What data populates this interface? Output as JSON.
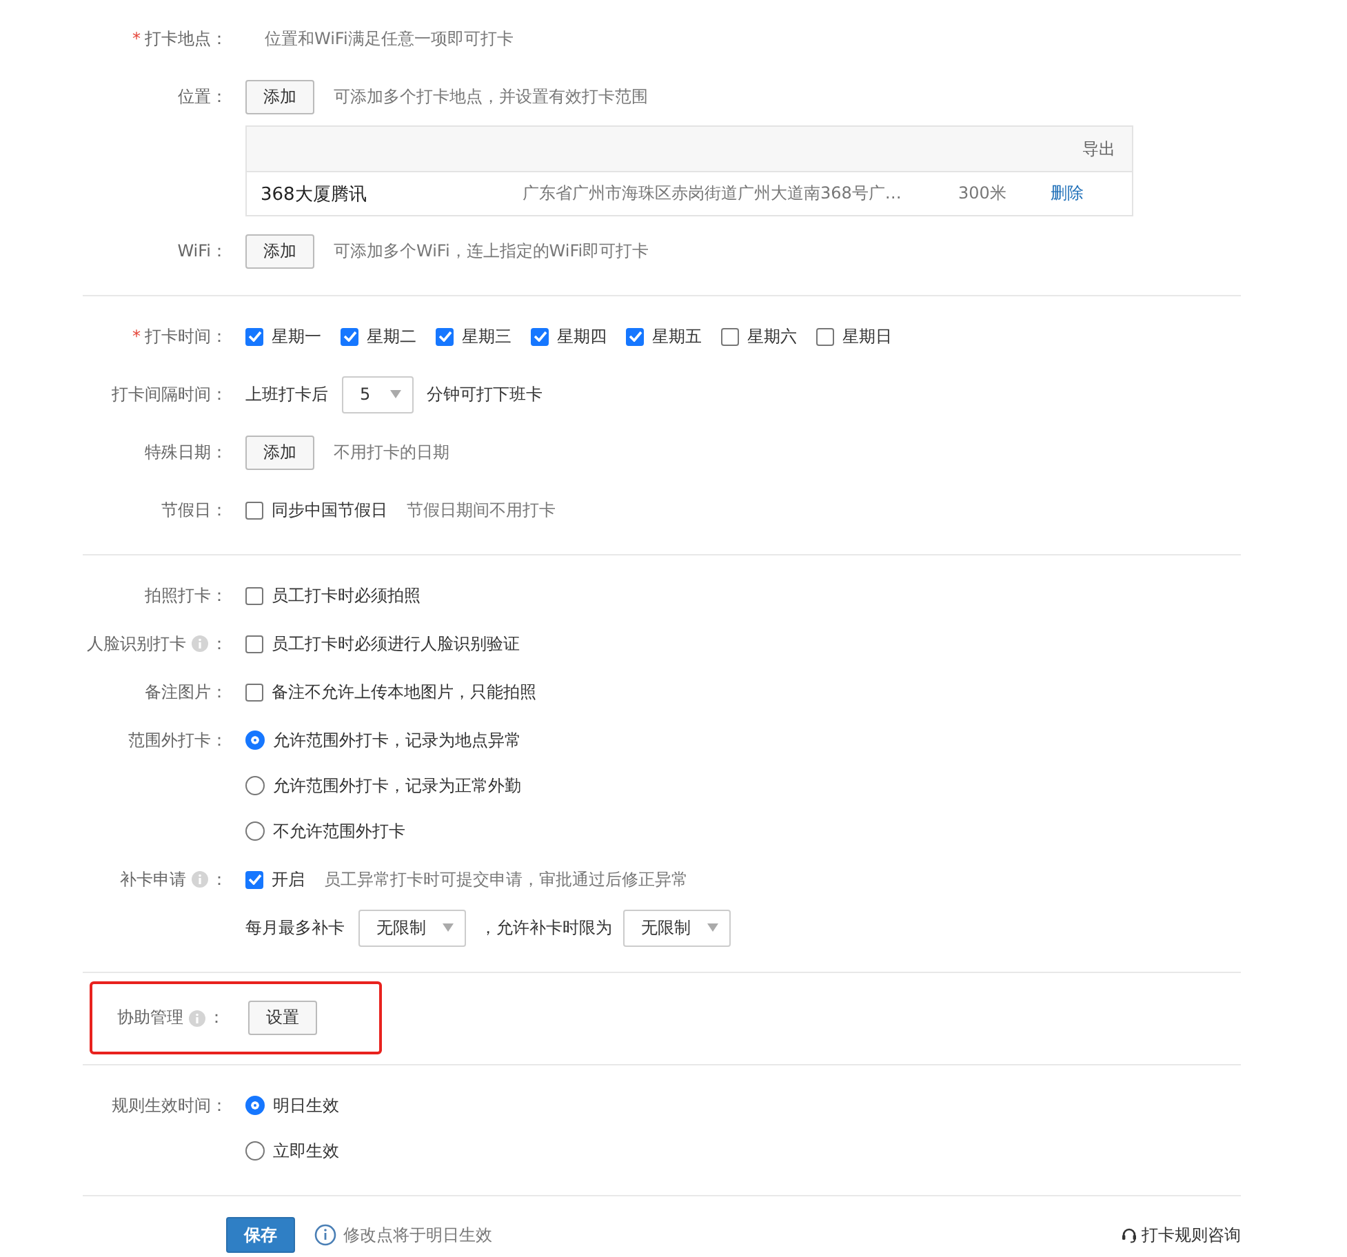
{
  "sections": [
    {
      "rows": [
        {
          "kind": "hint",
          "label": {
            "text": "打卡地点：",
            "mark": "*"
          },
          "text": "位置和WiFi满足任意一项即可打卡"
        },
        {
          "kind": "button",
          "label": {
            "text": "位置："
          },
          "button": "添加",
          "hint": "可添加多个打卡地点，并设置有效打卡范围"
        },
        {
          "kind": "table",
          "header": "导出",
          "rows": [
            {
              "name": "368大厦腾讯",
              "address": "广东省广州市海珠区赤岗街道广州大道南368号广…",
              "range": "300米",
              "action": "删除"
            }
          ]
        },
        {
          "kind": "button",
          "label": {
            "text": "WiFi："
          },
          "button": "添加",
          "hint": "可添加多个WiFi，连上指定的WiFi即可打卡"
        }
      ]
    },
    {
      "rows": [
        {
          "kind": "checks",
          "label": {
            "text": "打卡时间：",
            "mark": "*"
          },
          "options": [
            {
              "text": "星期一",
              "checked": true
            },
            {
              "text": "星期二",
              "checked": true
            },
            {
              "text": "星期三",
              "checked": true
            },
            {
              "text": "星期四",
              "checked": true
            },
            {
              "text": "星期五",
              "checked": true
            },
            {
              "text": "星期六",
              "checked": false
            },
            {
              "text": "星期日",
              "checked": false
            }
          ]
        },
        {
          "kind": "interval",
          "label": {
            "text": "打卡间隔时间："
          },
          "before": "上班打卡后",
          "select": "5",
          "after": "分钟可打下班卡"
        },
        {
          "kind": "button",
          "label": {
            "text": "特殊日期："
          },
          "button": "添加",
          "hint": "不用打卡的日期"
        },
        {
          "kind": "check",
          "label": {
            "text": "节假日："
          },
          "checked": false,
          "text": "同步中国节假日",
          "hint": "节假日期间不用打卡"
        }
      ]
    },
    {
      "rows": [
        {
          "kind": "check",
          "label": {
            "text": "拍照打卡："
          },
          "checked": false,
          "text": "员工打卡时必须拍照"
        },
        {
          "kind": "check",
          "label": {
            "text": "人脸识别打卡",
            "info": true,
            "colon": "："
          },
          "checked": false,
          "text": "员工打卡时必须进行人脸识别验证"
        },
        {
          "kind": "check",
          "label": {
            "text": "备注图片："
          },
          "checked": false,
          "text": "备注不允许上传本地图片，只能拍照"
        },
        {
          "kind": "radios",
          "label": {
            "text": "范围外打卡："
          },
          "options": [
            {
              "text": "允许范围外打卡，记录为地点异常",
              "selected": true
            },
            {
              "text": "允许范围外打卡，记录为正常外勤",
              "selected": false
            },
            {
              "text": "不允许范围外打卡",
              "selected": false
            }
          ]
        },
        {
          "kind": "check",
          "label": {
            "text": "补卡申请",
            "info": true,
            "colon": "："
          },
          "checked": true,
          "text": "开启",
          "hint": "员工异常打卡时可提交申请，审批通过后修正异常"
        },
        {
          "kind": "limits",
          "before": "每月最多补卡",
          "select": "无限制",
          "middle": "，允许补卡时限为",
          "select2": "无限制"
        }
      ]
    },
    {
      "highlighted": true,
      "rows": [
        {
          "kind": "button",
          "label": {
            "text": "协助管理",
            "info": true,
            "colon": "："
          },
          "button": "设置"
        }
      ]
    },
    {
      "rows": [
        {
          "kind": "radios",
          "label": {
            "text": "规则生效时间："
          },
          "options": [
            {
              "text": "明日生效",
              "selected": true
            },
            {
              "text": "立即生效",
              "selected": false
            }
          ]
        }
      ]
    }
  ],
  "footer": {
    "save": "保存",
    "note": "修改点将于明日生效",
    "help": "打卡规则咨询"
  }
}
